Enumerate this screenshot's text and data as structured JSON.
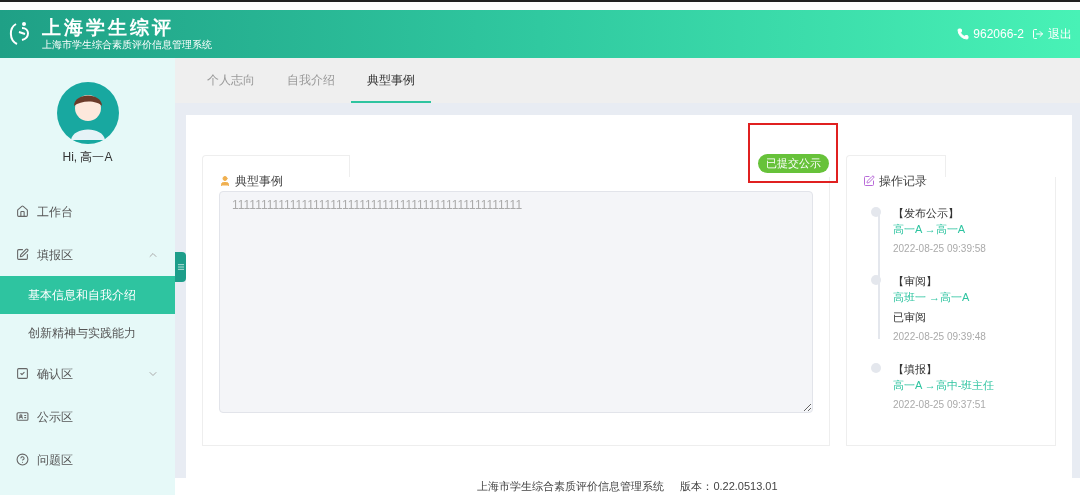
{
  "header": {
    "title": "上海学生综评",
    "subtitle": "上海市学生综合素质评价信息管理系统",
    "phone": "962066-2",
    "logout": "退出"
  },
  "user": {
    "greeting": "Hi, 高一A"
  },
  "sidebar": {
    "items": [
      {
        "kind": "home",
        "label": "工作台"
      },
      {
        "kind": "edit",
        "label": "填报区",
        "expanded": true,
        "children": [
          {
            "label": "基本信息和自我介绍",
            "selected": true
          },
          {
            "label": "创新精神与实践能力",
            "selected": false
          }
        ]
      },
      {
        "kind": "check",
        "label": "确认区",
        "expanded": false
      },
      {
        "kind": "card",
        "label": "公示区"
      },
      {
        "kind": "help",
        "label": "问题区"
      }
    ]
  },
  "tabs": [
    {
      "label": "个人志向",
      "selected": false
    },
    {
      "label": "自我介绍",
      "selected": false
    },
    {
      "label": "典型事例",
      "selected": true
    }
  ],
  "status_badge": "已提交公示",
  "case_card": {
    "title": "典型事例",
    "value": "11111111111111111111111111111111111111111111111111"
  },
  "log_card": {
    "title": "操作记录",
    "entries": [
      {
        "action": "【发布公示】",
        "route": "高一A →高一A",
        "time": "2022-08-25 09:39:58"
      },
      {
        "action": "【审阅】",
        "route": "高班一 →高一A",
        "note": "已审阅",
        "time": "2022-08-25 09:39:48"
      },
      {
        "action": "【填报】",
        "route": "高一A →高中-班主任",
        "time": "2022-08-25 09:37:51"
      }
    ]
  },
  "footer": {
    "system": "上海市学生综合素质评价信息管理系统",
    "version": "版本：0.22.0513.01"
  }
}
